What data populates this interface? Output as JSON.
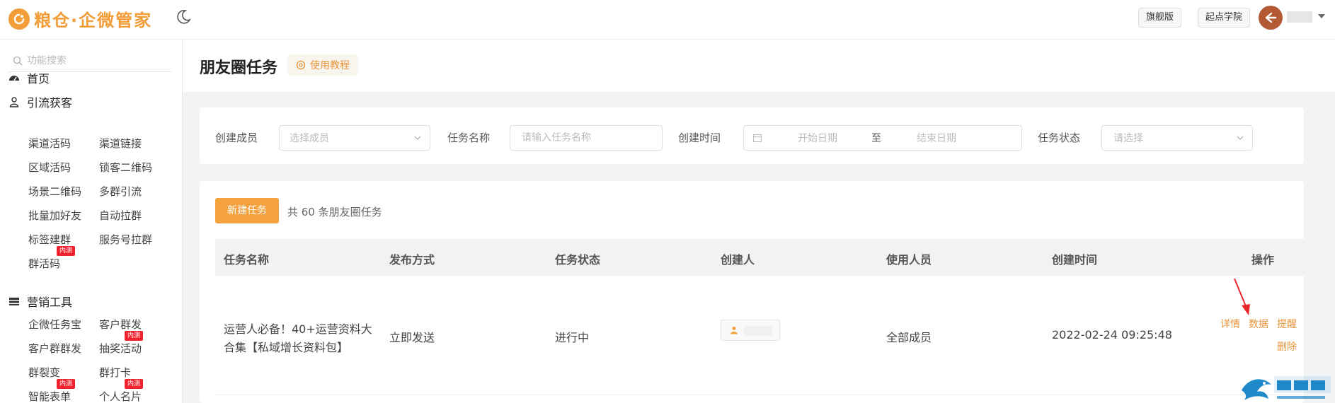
{
  "app": {
    "logo_text": "粮仓·企微管家",
    "flagship_label": "旗舰版",
    "academy_label": "起点学院"
  },
  "sidebar": {
    "search_placeholder": "功能搜索",
    "home": "首页",
    "group1": {
      "title": "引流获客",
      "items": [
        "渠道活码",
        "渠道链接",
        "区域活码",
        "锁客二维码",
        "场景二维码",
        "多群引流",
        "批量加好友",
        "自动拉群",
        "标签建群",
        "服务号拉群",
        "群活码"
      ]
    },
    "group2": {
      "title": "营销工具",
      "items": [
        "企微任务宝",
        "客户群发",
        "客户群群发",
        "抽奖活动",
        "群裂变",
        "群打卡",
        "智能表单",
        "个人名片"
      ]
    },
    "badge_text": "内测"
  },
  "page": {
    "title": "朋友圈任务",
    "tutorial_label": "使用教程"
  },
  "filters": {
    "creator_label": "创建成员",
    "creator_placeholder": "选择成员",
    "name_label": "任务名称",
    "name_placeholder": "请输入任务名称",
    "time_label": "创建时间",
    "start_placeholder": "开始日期",
    "range_sep": "至",
    "end_placeholder": "结束日期",
    "status_label": "任务状态",
    "status_placeholder": "请选择"
  },
  "list": {
    "new_button": "新建任务",
    "count_text": "共 60 条朋友圈任务",
    "columns": [
      "任务名称",
      "发布方式",
      "任务状态",
      "创建人",
      "使用人员",
      "创建时间",
      "操作"
    ],
    "rows": [
      {
        "name_line1": "运营人必备！40+运营资料大",
        "name_line2": "合集【私域增长资料包】",
        "method": "立即发送",
        "status": "进行中",
        "users": "全部成员",
        "created": "2022-02-24 09:25:48",
        "ops": [
          "详情",
          "数据",
          "提醒",
          "删除"
        ]
      }
    ]
  },
  "colors": {
    "accent": "#f3a23d",
    "badge": "#f0242e",
    "annotation_arrow": "#e8262b"
  }
}
